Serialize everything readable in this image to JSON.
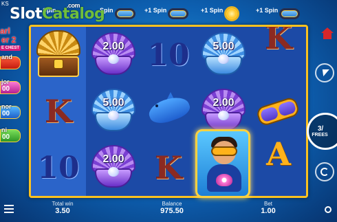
{
  "watermark": {
    "slot": "Slot",
    "catalog": "Catalog",
    "com": ".com"
  },
  "brand_tl": "KS",
  "top_spins": [
    {
      "label": "Spin"
    },
    {
      "label": "Spin"
    },
    {
      "label": "+1 Spin"
    },
    {
      "label": "+1 Spin"
    },
    {
      "label": "+1 Spin"
    }
  ],
  "logo": {
    "line1": "arl",
    "line2": "er 2",
    "sub": "E CHEST"
  },
  "jackpots": [
    {
      "label": "and",
      "value": ""
    },
    {
      "label": "jor",
      "value": "00"
    },
    {
      "label": "nor",
      "value": "00"
    },
    {
      "label": "ni",
      "value": "00"
    }
  ],
  "reels": {
    "row1": [
      "chest",
      "2.00",
      "10",
      "5.00",
      "K"
    ],
    "row2": [
      "K",
      "5.00",
      "dolphin",
      "2.00",
      "goggles"
    ],
    "row3": [
      "10",
      "2.00",
      "K",
      "diver",
      "A"
    ]
  },
  "shells": {
    "r1c2": "2.00",
    "r1c4": "5.00",
    "r2c2": "5.00",
    "r2c4": "2.00",
    "r3c2": "2.00"
  },
  "symbols": {
    "k": "K",
    "ten": "10",
    "a": "A"
  },
  "controls": {
    "spin_count": "3/",
    "freespins_label": "FREES"
  },
  "bottom": {
    "total_win_label": "Total win",
    "total_win_value": "3.50",
    "balance_label": "Balance",
    "balance_value": "975.50",
    "bet_label": "Bet",
    "bet_value": "1.00"
  },
  "colors": {
    "frame": "#ffc21f",
    "grand": "#c21a0f",
    "major": "#b3208f",
    "minor": "#1e5fc7",
    "mini": "#2e9626"
  }
}
